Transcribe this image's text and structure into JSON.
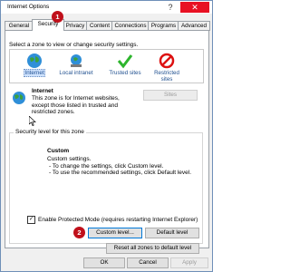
{
  "window": {
    "title": "Internet Options",
    "help": "?",
    "close": "✕"
  },
  "tabs": [
    "General",
    "Security",
    "Privacy",
    "Content",
    "Connections",
    "Programs",
    "Advanced"
  ],
  "markers": [
    "1",
    "2"
  ],
  "zones": {
    "label": "Select a zone to view or change security settings.",
    "items": [
      {
        "label": "Internet",
        "icon": "globe-icon"
      },
      {
        "label": "Local intranet",
        "icon": "intranet-icon"
      },
      {
        "label": "Trusted sites",
        "icon": "checkmark-icon"
      },
      {
        "label": "Restricted sites",
        "icon": "no-entry-icon"
      }
    ]
  },
  "zone_info": {
    "heading": "Internet",
    "description": "This zone is for Internet websites, except those listed in trusted and restricted zones.",
    "sites_button": "Sites"
  },
  "security_level": {
    "group_label": "Security level for this zone",
    "heading": "Custom",
    "lines": [
      "Custom settings.",
      "- To change the settings, click Custom level.",
      "- To use the recommended settings, click Default level."
    ],
    "protected_mode": "Enable Protected Mode (requires restarting Internet Explorer)",
    "protected_mode_checked": true,
    "custom_button": "Custom level...",
    "default_button": "Default level",
    "reset_button": "Reset all zones to default level"
  },
  "footer": {
    "ok": "OK",
    "cancel": "Cancel",
    "apply": "Apply"
  },
  "colors": {
    "accent": "#0078d7",
    "marker": "#c0101b",
    "close": "#e81123"
  }
}
